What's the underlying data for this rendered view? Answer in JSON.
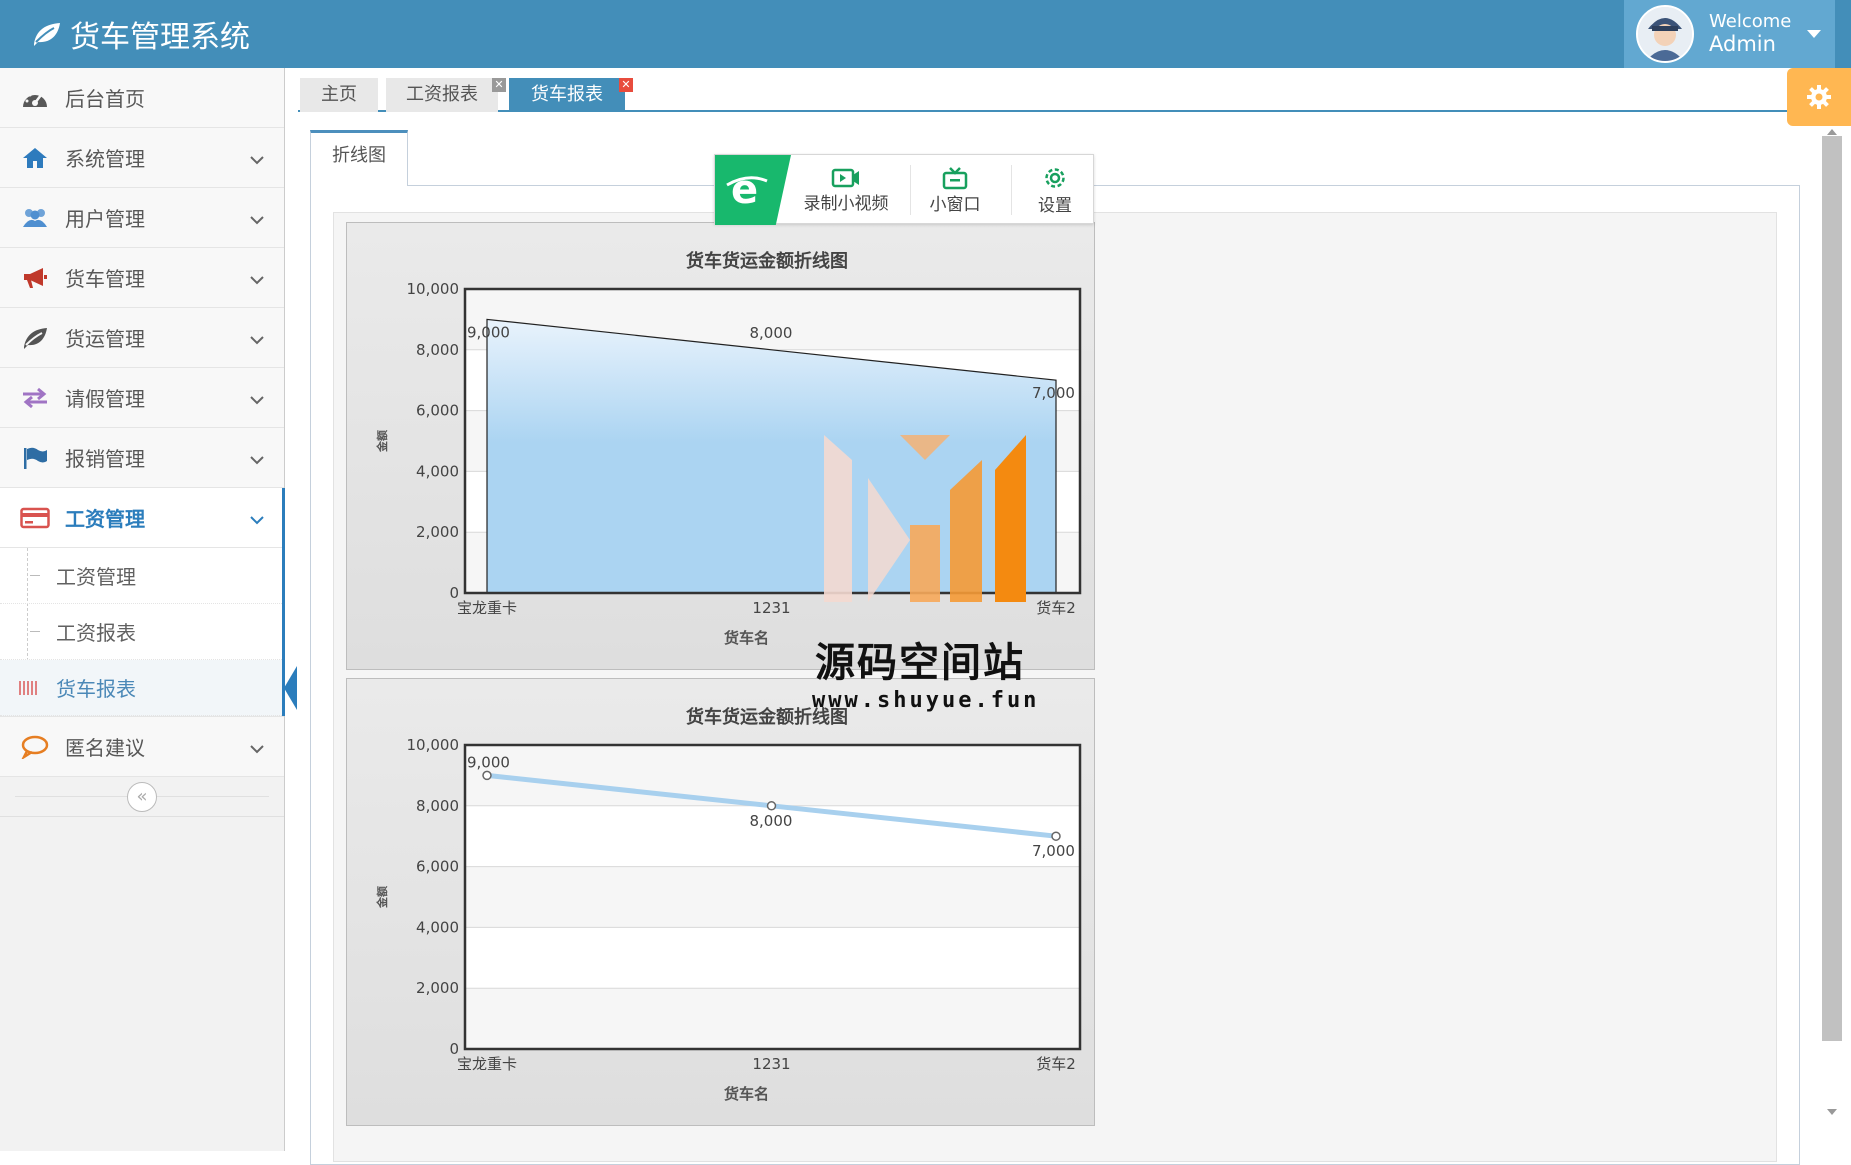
{
  "navbar": {
    "title": "货车管理系统",
    "welcome": "Welcome",
    "user": "Admin",
    "bg_color": "#438eb9"
  },
  "sidebar": {
    "items": [
      {
        "label": "后台首页",
        "icon": "dashboard-icon"
      },
      {
        "label": "系统管理",
        "icon": "home-icon"
      },
      {
        "label": "用户管理",
        "icon": "users-icon"
      },
      {
        "label": "货车管理",
        "icon": "bullhorn-icon"
      },
      {
        "label": "货运管理",
        "icon": "leaf-icon"
      },
      {
        "label": "请假管理",
        "icon": "exchange-icon"
      },
      {
        "label": "报销管理",
        "icon": "flag-icon"
      },
      {
        "label": "工资管理",
        "icon": "credit-card-icon"
      }
    ],
    "submenu": [
      {
        "label": "工资管理"
      },
      {
        "label": "工资报表"
      },
      {
        "label": "货车报表"
      }
    ],
    "last_item": {
      "label": "匿名建议",
      "icon": "comment-icon"
    },
    "collapse_glyph": "«"
  },
  "tabs": [
    {
      "label": "主页",
      "closable": false
    },
    {
      "label": "工资报表",
      "closable": true
    },
    {
      "label": "货车报表",
      "closable": true,
      "active": true
    }
  ],
  "inner_tab": {
    "label": "折线图"
  },
  "ie_toolbar": {
    "record_label": "录制小视频",
    "window_label": "小窗口",
    "settings_label": "设置"
  },
  "watermark": {
    "text": "源码空间站",
    "url": "www.shuyue.fun"
  },
  "chart_data": [
    {
      "type": "area",
      "title": "货车货运金额折线图",
      "xlabel": "货车名",
      "ylabel": "金额",
      "categories": [
        "宝龙重卡",
        "1231",
        "货车2"
      ],
      "values": [
        9000,
        8000,
        7000
      ],
      "data_labels": [
        "9,000",
        "8,000",
        "7,000"
      ],
      "yticks": [
        "0",
        "2,000",
        "4,000",
        "6,000",
        "8,000",
        "10,000"
      ],
      "ylim": [
        0,
        10000
      ],
      "grid": true,
      "color": "#abd4f2"
    },
    {
      "type": "line",
      "title": "货车货运金额折线图",
      "xlabel": "货车名",
      "ylabel": "金额",
      "categories": [
        "宝龙重卡",
        "1231",
        "货车2"
      ],
      "values": [
        9000,
        8000,
        7000
      ],
      "data_labels": [
        "9,000",
        "8,000",
        "7,000"
      ],
      "yticks": [
        "0",
        "2,000",
        "4,000",
        "6,000",
        "8,000",
        "10,000"
      ],
      "ylim": [
        0,
        10000
      ],
      "grid": true,
      "color": "#a8d0ee"
    }
  ]
}
